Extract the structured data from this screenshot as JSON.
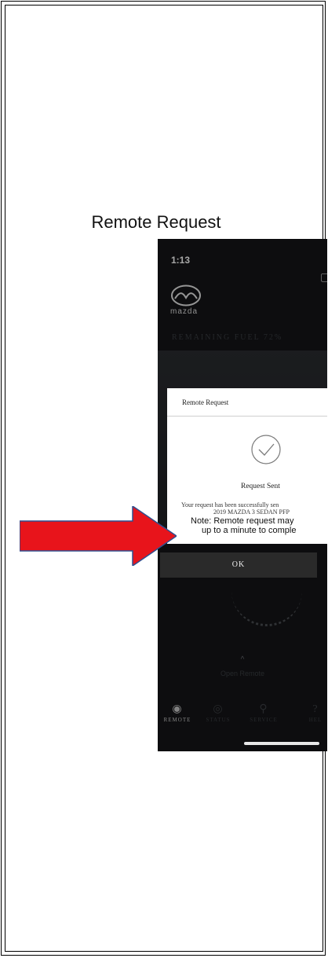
{
  "caption": "Remote Request",
  "phone": {
    "time": "1:13",
    "brand": "mazda",
    "remaining_fuel": "REMAINING FUEL 72%",
    "open_remote": "Open Remote",
    "tabs": [
      {
        "label": "REMOTE",
        "icon": "remote-icon",
        "active": true
      },
      {
        "label": "STATUS",
        "icon": "status-icon",
        "active": false
      },
      {
        "label": "SERVICE",
        "icon": "service-icon",
        "active": false
      },
      {
        "label": "HEL",
        "icon": "help-icon",
        "active": false
      }
    ]
  },
  "modal": {
    "title": "Remote Request",
    "status": "Request Sent",
    "message_line1": "Your request has been successfully sen",
    "message_line2": "2019 MAZDA 3 SEDAN PFP",
    "note_line1": "Note: Remote request may",
    "note_line2": "up to a minute to comple",
    "ok_label": "OK"
  },
  "colors": {
    "phone_bg": "#141517",
    "arrow": "#e8141b",
    "button_bg": "#2a2a2a"
  }
}
